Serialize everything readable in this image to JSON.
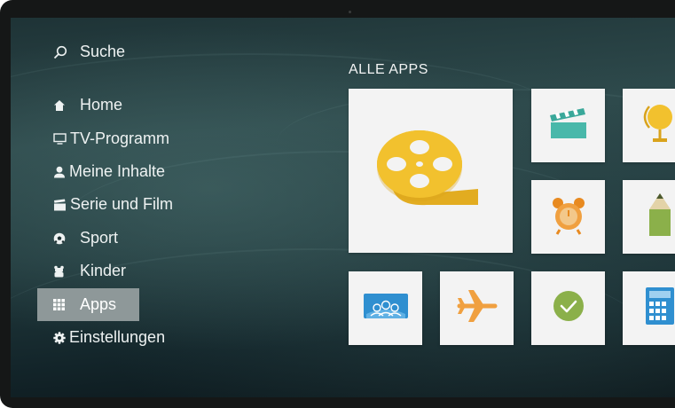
{
  "menu": {
    "search_label": "Suche",
    "items": [
      {
        "label": "Home",
        "icon": "home-icon"
      },
      {
        "label": "TV-Programm",
        "icon": "tv-icon"
      },
      {
        "label": "Meine Inhalte",
        "icon": "user-icon"
      },
      {
        "label": "Serie und Film",
        "icon": "clapperboard-icon"
      },
      {
        "label": "Sport",
        "icon": "soccer-ball-icon"
      },
      {
        "label": "Kinder",
        "icon": "teddy-bear-icon"
      },
      {
        "label": "Apps",
        "icon": "grid-icon",
        "active": true
      },
      {
        "label": "Einstellungen",
        "icon": "gear-icon"
      }
    ]
  },
  "apps": {
    "title": "ALLE APPS",
    "tiles": [
      {
        "icon": "film-reel-icon",
        "featured": true
      },
      {
        "icon": "clapperboard-icon"
      },
      {
        "icon": "globe-icon"
      },
      {
        "icon": "alarm-clock-icon"
      },
      {
        "icon": "pencil-icon"
      },
      {
        "icon": "group-icon"
      },
      {
        "icon": "airplane-icon"
      },
      {
        "icon": "clock-check-icon"
      },
      {
        "icon": "calculator-icon"
      }
    ]
  },
  "colors": {
    "accent_yellow": "#e9b82a",
    "accent_orange": "#f0a040",
    "accent_green": "#8bb04a",
    "accent_blue": "#2f8fd0",
    "active_menu_bg": "#8e9899"
  }
}
